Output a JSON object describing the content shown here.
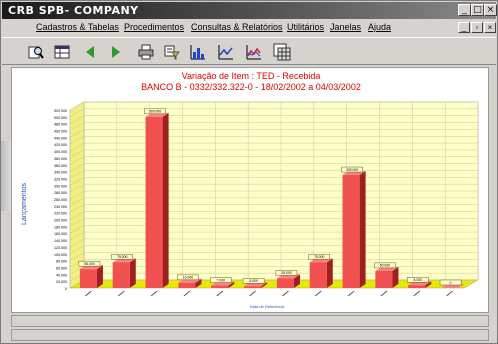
{
  "window": {
    "title": "CRB SPB- COMPANY",
    "min": "_",
    "max": "□",
    "close": "×"
  },
  "menu": {
    "items": [
      "Cadastros & Tabelas",
      "Procedimentos",
      "Consultas & Relatórios",
      "Utilitários",
      "Janelas",
      "Ajuda"
    ]
  },
  "toolbar": {
    "icons": [
      "search-icon",
      "table-icon",
      "back-arrow-icon",
      "forward-arrow-icon",
      "print-icon",
      "filter-icon",
      "bar-chart-icon",
      "line-chart-icon",
      "area-chart-icon",
      "grid-chart-icon"
    ]
  },
  "chart_title": {
    "line1": "Variação de Item : TED - Recebida",
    "line2": "BANCO B - 0332/332.322-0 - 18/02/2002 a 04/03/2002"
  },
  "chart_data": {
    "type": "bar",
    "ylabel": "Lançamentos",
    "xlabel": "Data de Referência",
    "ylim": [
      0,
      520000
    ],
    "categories": [
      "",
      "",
      "",
      "",
      "",
      "",
      "",
      "",
      "",
      "",
      "",
      ""
    ],
    "values": [
      55000,
      75000,
      500000,
      15000,
      7000,
      5000,
      28000,
      75000,
      330000,
      50000,
      8000,
      0
    ],
    "ticks": [
      "0",
      "20.000",
      "40.000",
      "60.000",
      "80.000",
      "100.000",
      "120.000",
      "140.000",
      "160.000",
      "180.000",
      "200.000",
      "220.000",
      "240.000",
      "260.000",
      "280.000",
      "300.000",
      "320.000",
      "340.000",
      "360.000",
      "380.000",
      "400.000",
      "420.000",
      "440.000",
      "460.000",
      "480.000",
      "500.000",
      "520.000"
    ],
    "colors": {
      "bar": "#f05050",
      "bar_side": "#a02020",
      "bar_top": "#ff8080",
      "wall": "#ffffc8",
      "floor": "#e8e800",
      "grid": "#c8c8a0",
      "title": "#e00000",
      "axis_label": "#3050c0"
    }
  }
}
